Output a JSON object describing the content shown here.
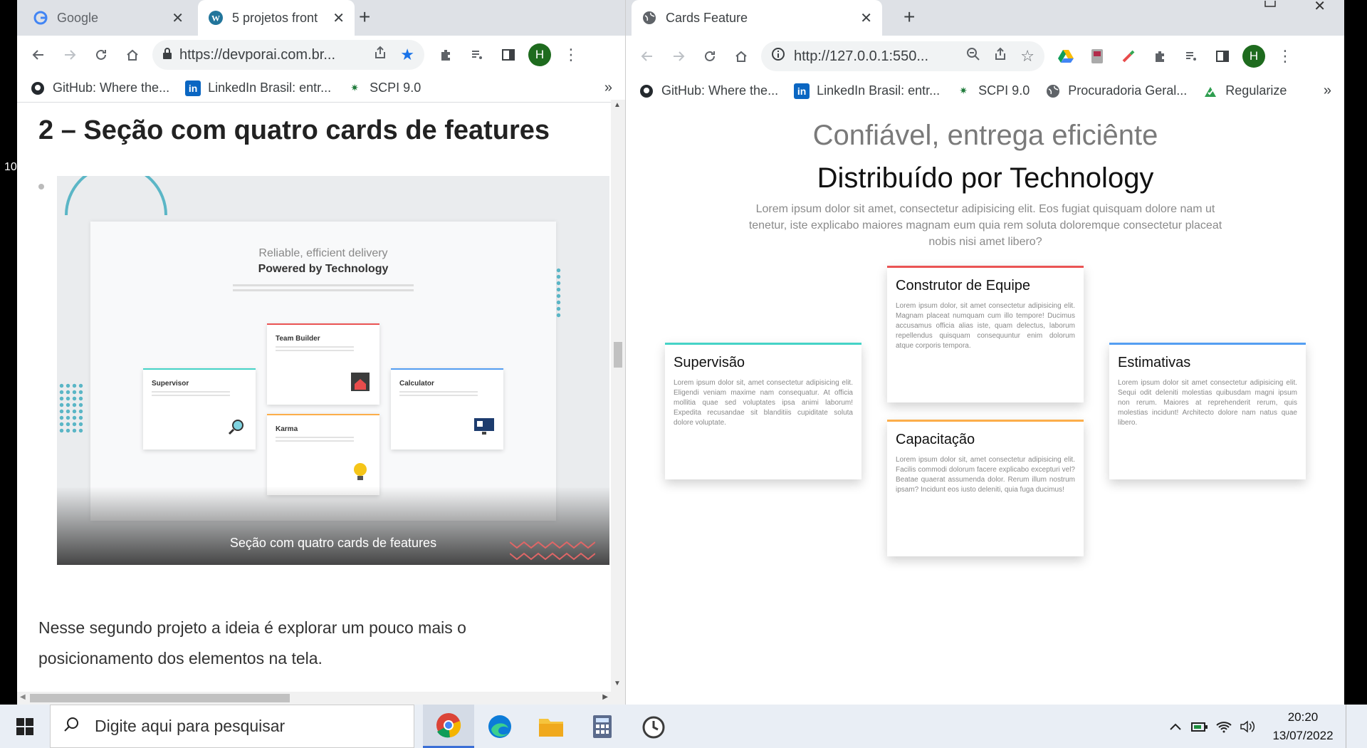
{
  "left_browser": {
    "tabs": [
      {
        "title": "Google",
        "close": "✕",
        "active": false
      },
      {
        "title": "5 projetos front",
        "close": "✕",
        "active": true
      }
    ],
    "newtab": "+",
    "url": "https://devporai.com.br...",
    "avatar": "H",
    "bookmarks": [
      {
        "label": "GitHub: Where the...",
        "icon": "github-icon"
      },
      {
        "label": "LinkedIn Brasil: entr...",
        "icon": "linkedin-icon"
      },
      {
        "label": "SCPI 9.0",
        "icon": "scpi-icon"
      }
    ],
    "bookmarks_more": "»",
    "page": {
      "title": "2 – Seção com quatro cards de features",
      "image_caption": "Seção com quatro cards de features",
      "paragraph": "Nesse segundo projeto a ideia é explorar um pouco mais o posicionamento dos elementos na tela.",
      "mini": {
        "sub": "Reliable, efficient delivery",
        "title": "Powered by Technology",
        "cards": [
          "Supervisor",
          "Team Builder",
          "Karma",
          "Calculator"
        ]
      }
    }
  },
  "right_browser": {
    "tab": {
      "title": "Cards Feature",
      "close": "✕"
    },
    "newtab": "+",
    "url": "http://127.0.0.1:550...",
    "avatar": "H",
    "bookmarks": [
      {
        "label": "GitHub: Where the...",
        "icon": "github-icon"
      },
      {
        "label": "LinkedIn Brasil: entr...",
        "icon": "linkedin-icon"
      },
      {
        "label": "SCPI 9.0",
        "icon": "scpi-icon"
      },
      {
        "label": "Procuradoria Geral...",
        "icon": "globe-icon"
      },
      {
        "label": "Regularize",
        "icon": "regularize-icon"
      }
    ],
    "bookmarks_more": "»",
    "page": {
      "subtitle": "Confiável, entrega eficiênte",
      "title": "Distribuído por Technology",
      "description": "Lorem ipsum dolor sit amet, consectetur adipisicing elit. Eos fugiat quisquam dolore nam ut tenetur, iste explicabo maiores magnam eum quia rem soluta doloremque consectetur placeat nobis nisi amet libero?",
      "cards": [
        {
          "title": "Supervisão",
          "text": "Lorem ipsum dolor sit, amet consectetur adipisicing elit. Eligendi veniam maxime nam consequatur. At officia mollitia quae sed voluptates ipsa animi laborum! Expedita recusandae sit blanditiis cupiditate soluta dolore voluptate."
        },
        {
          "title": "Construtor de Equipe",
          "text": "Lorem ipsum dolor, sit amet consectetur adipisicing elit. Magnam placeat numquam cum illo tempore! Ducimus accusamus officia alias iste, quam delectus, laborum repellendus quisquam consequuntur enim dolorum atque corporis tempora."
        },
        {
          "title": "Capacitação",
          "text": "Lorem ipsum dolor sit, amet consectetur adipisicing elit. Facilis commodi dolorum facere explicabo excepturi vel? Beatae quaerat assumenda dolor. Rerum illum nostrum ipsam? Incidunt eos iusto deleniti, quia fuga ducimus!"
        },
        {
          "title": "Estimativas",
          "text": "Lorem ipsum dolor sit amet consectetur adipisicing elit. Sequi odit deleniti molestias quibusdam magni ipsum non rerum. Maiores at reprehenderit rerum, quis molestias incidunt! Architecto dolore nam natus quae libero."
        }
      ]
    }
  },
  "taskbar": {
    "search_placeholder": "Digite aqui para pesquisar",
    "apps": [
      "chrome-icon",
      "edge-icon",
      "file-explorer-icon",
      "calculator-icon",
      "clock-app-icon"
    ],
    "time": "20:20",
    "date": "13/07/2022"
  },
  "side_text": "10",
  "colors": {
    "cyan": "#45d3c7",
    "red": "#ea5454",
    "orange": "#fcae4a",
    "blue": "#549ef2",
    "avatar": "#1e6b1e"
  }
}
